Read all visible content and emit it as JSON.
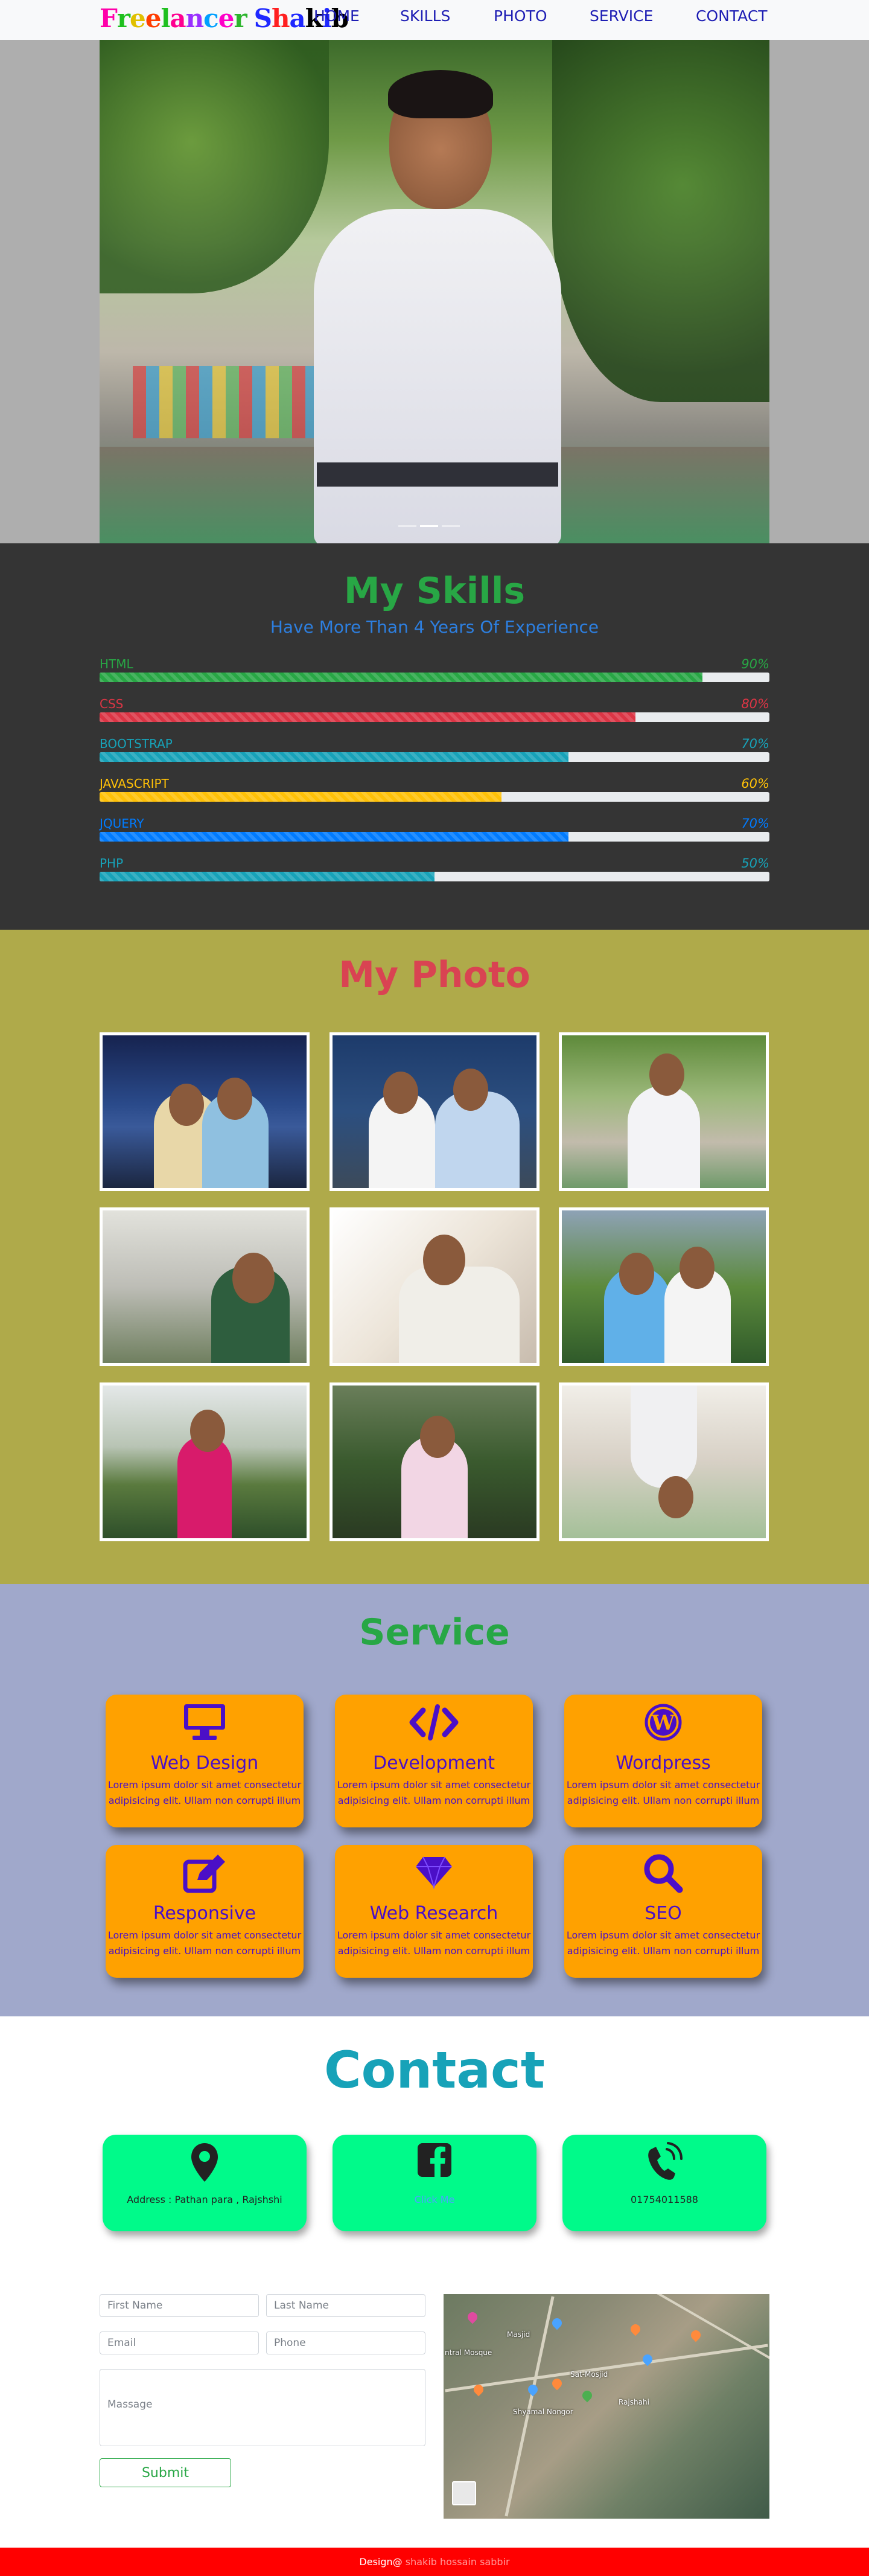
{
  "nav": {
    "brand_letters": [
      {
        "ch": "F",
        "color": "#ff00aa"
      },
      {
        "ch": "r",
        "color": "#1ec01e"
      },
      {
        "ch": "e",
        "color": "#e0c000"
      },
      {
        "ch": "e",
        "color": "#ff3d00"
      },
      {
        "ch": "l",
        "color": "#20c020"
      },
      {
        "ch": "a",
        "color": "#ff0090"
      },
      {
        "ch": "n",
        "color": "#9a30ff"
      },
      {
        "ch": "c",
        "color": "#00a0ff"
      },
      {
        "ch": "e",
        "color": "#ff00c8"
      },
      {
        "ch": "r",
        "color": "#2db52d"
      },
      {
        "ch": " ",
        "color": "#000000"
      },
      {
        "ch": "S",
        "color": "#1e28ff"
      },
      {
        "ch": "h",
        "color": "#ff2020"
      },
      {
        "ch": "a",
        "color": "#1e28ff"
      },
      {
        "ch": "k",
        "color": "#000000"
      },
      {
        "ch": "i",
        "color": "#1e28ff"
      },
      {
        "ch": "b",
        "color": "#000000"
      }
    ],
    "links": [
      "HOME",
      "SKILLS",
      "PHOTO",
      "SERVICE",
      "CONTACT"
    ]
  },
  "skills": {
    "title": "My Skills",
    "subtitle": "Have More Than 4 Years Of Experience",
    "items": [
      {
        "label": "HTML",
        "percent": "90%",
        "value": 0.9,
        "color": "#28a745"
      },
      {
        "label": "CSS",
        "percent": "80%",
        "value": 0.8,
        "color": "#dc3545"
      },
      {
        "label": "BOOTSTRAP",
        "percent": "70%",
        "value": 0.7,
        "color": "#17a2b8"
      },
      {
        "label": "JAVASCRIPT",
        "percent": "60%",
        "value": 0.6,
        "color": "#ffc107"
      },
      {
        "label": "JQUERY",
        "percent": "70%",
        "value": 0.7,
        "color": "#007bff"
      },
      {
        "label": "PHP",
        "percent": "50%",
        "value": 0.5,
        "color": "#17a2b8"
      }
    ]
  },
  "photo": {
    "title": "My Photo"
  },
  "service": {
    "title": "Service",
    "cards": [
      {
        "icon": "monitor-icon",
        "title": "Web Design",
        "text": "Lorem ipsum dolor sit amet consectetur adipisicing elit. Ullam non corrupti illum"
      },
      {
        "icon": "code-icon",
        "title": "Development",
        "text": "Lorem ipsum dolor sit amet consectetur adipisicing elit. Ullam non corrupti illum"
      },
      {
        "icon": "wordpress-icon",
        "title": "Wordpress",
        "text": "Lorem ipsum dolor sit amet consectetur adipisicing elit. Ullam non corrupti illum"
      },
      {
        "icon": "edit-icon",
        "title": "Responsive",
        "text": "Lorem ipsum dolor sit amet consectetur adipisicing elit. Ullam non corrupti illum"
      },
      {
        "icon": "gem-icon",
        "title": "Web Research",
        "text": "Lorem ipsum dolor sit amet consectetur adipisicing elit. Ullam non corrupti illum"
      },
      {
        "icon": "search-icon",
        "title": "SEO",
        "text": "Lorem ipsum dolor sit amet consectetur adipisicing elit. Ullam non corrupti illum"
      }
    ]
  },
  "contact": {
    "title": "Contact",
    "cards": [
      {
        "icon": "location-pin-icon",
        "text": "Address : Pathan para , Rajshshi"
      },
      {
        "icon": "facebook-icon",
        "text": "Click Me"
      },
      {
        "icon": "phone-icon",
        "text": "01754011588"
      }
    ],
    "form": {
      "first_name_placeholder": "First Name",
      "last_name_placeholder": "Last Name",
      "email_placeholder": "Email",
      "phone_placeholder": "Phone",
      "message_placeholder": "Massage",
      "submit_label": "Submit"
    },
    "map_labels": [
      "Masjid",
      "ntral Mosque",
      "Shyamal Nongor",
      "Rajshahi",
      "Sat-Mosjid"
    ]
  },
  "footer": {
    "prefix": "Design@",
    "author": "shakib hossain sabbir"
  },
  "colors": {
    "nav_link": "#1e1eb4",
    "skills_bg": "#343434",
    "photo_bg": "#afaa4a",
    "service_bg": "#a0a8cb",
    "service_card": "#ffa100",
    "contact_card": "#00fa8a",
    "footer_bg": "#ff0000"
  }
}
